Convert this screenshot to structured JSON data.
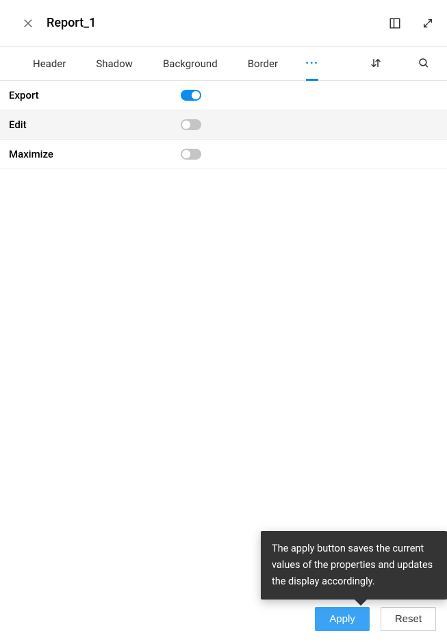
{
  "header": {
    "title": "Report_1"
  },
  "tabs": {
    "items": [
      {
        "label": "Header"
      },
      {
        "label": "Shadow"
      },
      {
        "label": "Background"
      },
      {
        "label": "Border"
      }
    ],
    "more": "···"
  },
  "settings": [
    {
      "label": "Export",
      "on": true,
      "alt": false
    },
    {
      "label": "Edit",
      "on": false,
      "alt": true
    },
    {
      "label": "Maximize",
      "on": false,
      "alt": false
    }
  ],
  "tooltip": {
    "text": "The apply button saves the current values of the properties and updates the display accordingly."
  },
  "footer": {
    "apply": "Apply",
    "reset": "Reset"
  }
}
